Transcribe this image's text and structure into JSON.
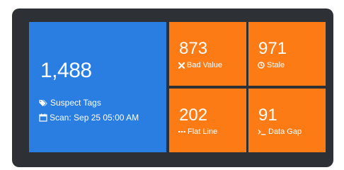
{
  "summary": {
    "count": "1,488",
    "label": "Suspect Tags",
    "label_icon": "tags-icon",
    "scan_text": "Scan: Sep 25 05:00 AM",
    "scan_icon": "calendar-icon",
    "color": "#2a7de1"
  },
  "metrics": [
    {
      "value": "873",
      "label": "Bad Value",
      "icon": "times-icon"
    },
    {
      "value": "971",
      "label": "Stale",
      "icon": "clock-icon"
    },
    {
      "value": "202",
      "label": "Flat Line",
      "icon": "ellipsis-icon"
    },
    {
      "value": "91",
      "label": "Data Gap",
      "icon": "terminal-icon"
    }
  ],
  "colors": {
    "panel_bg": "#2d3136",
    "metric_tile": "#fd7b14",
    "summary_tile": "#2a7de1",
    "text": "#ffffff"
  }
}
